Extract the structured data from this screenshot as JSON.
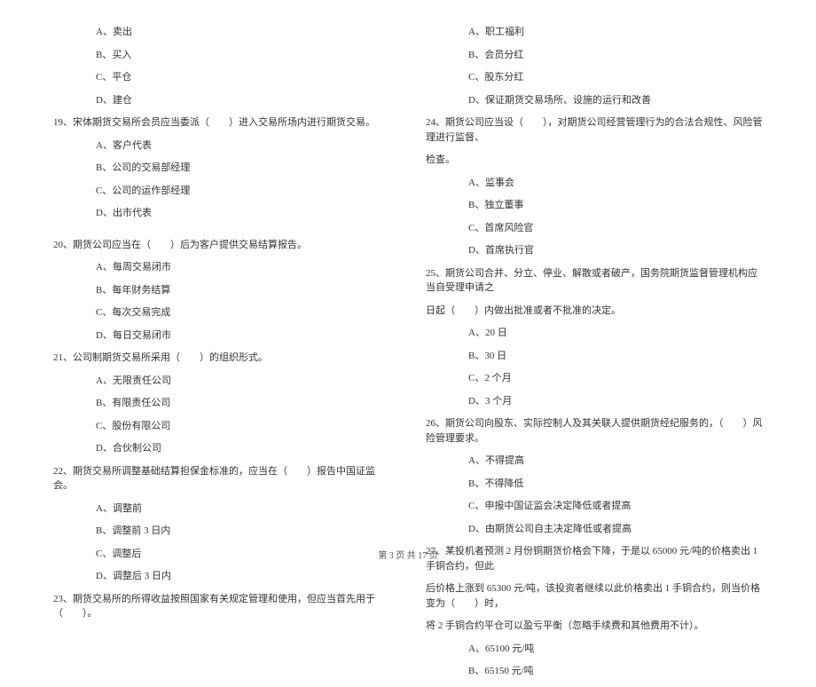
{
  "left": {
    "q18_options": [
      "A、卖出",
      "B、买入",
      "C、平仓",
      "D、建仓"
    ],
    "q19_text": "19、宋体期货交易所会员应当委派（　　）进入交易所场内进行期货交易。",
    "q19_options": [
      "A、客户代表",
      "B、公司的交易部经理",
      "C、公司的运作部经理",
      "D、出市代表"
    ],
    "q20_text": "20、期货公司应当在（　　）后为客户提供交易结算报告。",
    "q20_options": [
      "A、每周交易闭市",
      "B、每年财务结算",
      "C、每次交易完成",
      "D、每日交易闭市"
    ],
    "q21_text": "21、公司制期货交易所采用（　　）的组织形式。",
    "q21_options": [
      "A、无限责任公司",
      "B、有限责任公司",
      "C、股份有限公司",
      "D、合伙制公司"
    ],
    "q22_text": "22、期货交易所调整基础结算担保金标准的，应当在（　　）报告中国证监会。",
    "q22_options": [
      "A、调整前",
      "B、调整前 3 日内",
      "C、调整后",
      "D、调整后 3 日内"
    ],
    "q23_text": "23、期货交易所的所得收益按照国家有关规定管理和使用，但应当首先用于（　　）。"
  },
  "right": {
    "q23_options": [
      "A、职工福利",
      "B、会员分红",
      "C、股东分红",
      "D、保证期货交易场所、设施的运行和改善"
    ],
    "q24_text": "24、期货公司应当设（　　），对期货公司经营管理行为的合法合规性、风险管理进行监督、",
    "q24_text2": "检查。",
    "q24_options": [
      "A、监事会",
      "B、独立董事",
      "C、首席风险官",
      "D、首席执行官"
    ],
    "q25_text": "25、期货公司合并、分立、停业、解散或者破产，国务院期货监督管理机构应当自受理申请之",
    "q25_text2": "日起（　　）内做出批准或者不批准的决定。",
    "q25_options": [
      "A、20 日",
      "B、30 日",
      "C、2 个月",
      "D、3 个月"
    ],
    "q26_text": "26、期货公司向股东、实际控制人及其关联人提供期货经纪服务的，（　　）风险管理要求。",
    "q26_options": [
      "A、不得提高",
      "B、不得降低",
      "C、申报中国证监会决定降低或者提高",
      "D、由期货公司自主决定降低或者提高"
    ],
    "q27_text": "27、某投机者预测 2 月份铜期货价格会下降，于是以 65000 元/吨的价格卖出 1 手铜合约，但此",
    "q27_text2": "后价格上涨到 65300 元/吨，该投资者继续以此价格卖出 1 手铜合约，则当价格变为（　　）时，",
    "q27_text3": "将 2 手铜合约平仓可以盈亏平衡（忽略手续费和其他费用不计）。",
    "q27_options": [
      "A、65100 元/吨",
      "B、65150 元/吨"
    ]
  },
  "footer": "第 3 页 共 17 页"
}
